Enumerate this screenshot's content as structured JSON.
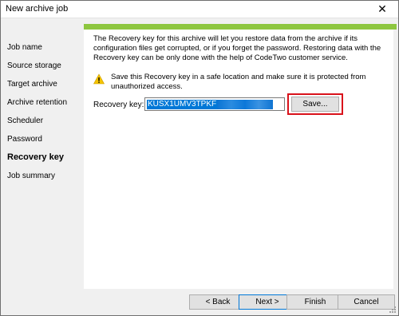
{
  "window": {
    "title": "New archive job",
    "close_glyph": "✕"
  },
  "sidebar": {
    "items": [
      {
        "label": "Job name"
      },
      {
        "label": "Source storage"
      },
      {
        "label": "Target archive"
      },
      {
        "label": "Archive retention"
      },
      {
        "label": "Scheduler"
      },
      {
        "label": "Password"
      },
      {
        "label": "Recovery key",
        "active": true
      },
      {
        "label": "Job summary"
      }
    ]
  },
  "main": {
    "description": "The Recovery key for this archive will let you restore data from the archive if its configuration files get corrupted, or if you forget the password. Restoring data with the Recovery key can be only done with the help of CodeTwo customer service.",
    "warning": {
      "icon": "warning-icon",
      "text": "Save this Recovery key in a safe location and make sure it is protected from unauthorized access."
    },
    "recovery_key": {
      "label": "Recovery key:",
      "value_visible": "KUSX1UMV3TPKF"
    },
    "save_button": "Save..."
  },
  "footer": {
    "back": "< Back",
    "next": "Next >",
    "finish": "Finish",
    "cancel": "Cancel"
  },
  "colors": {
    "accent_strip": "#8dc63f",
    "highlight": "#d9121b",
    "selection": "#0078d7",
    "warning": "#f5c400"
  }
}
